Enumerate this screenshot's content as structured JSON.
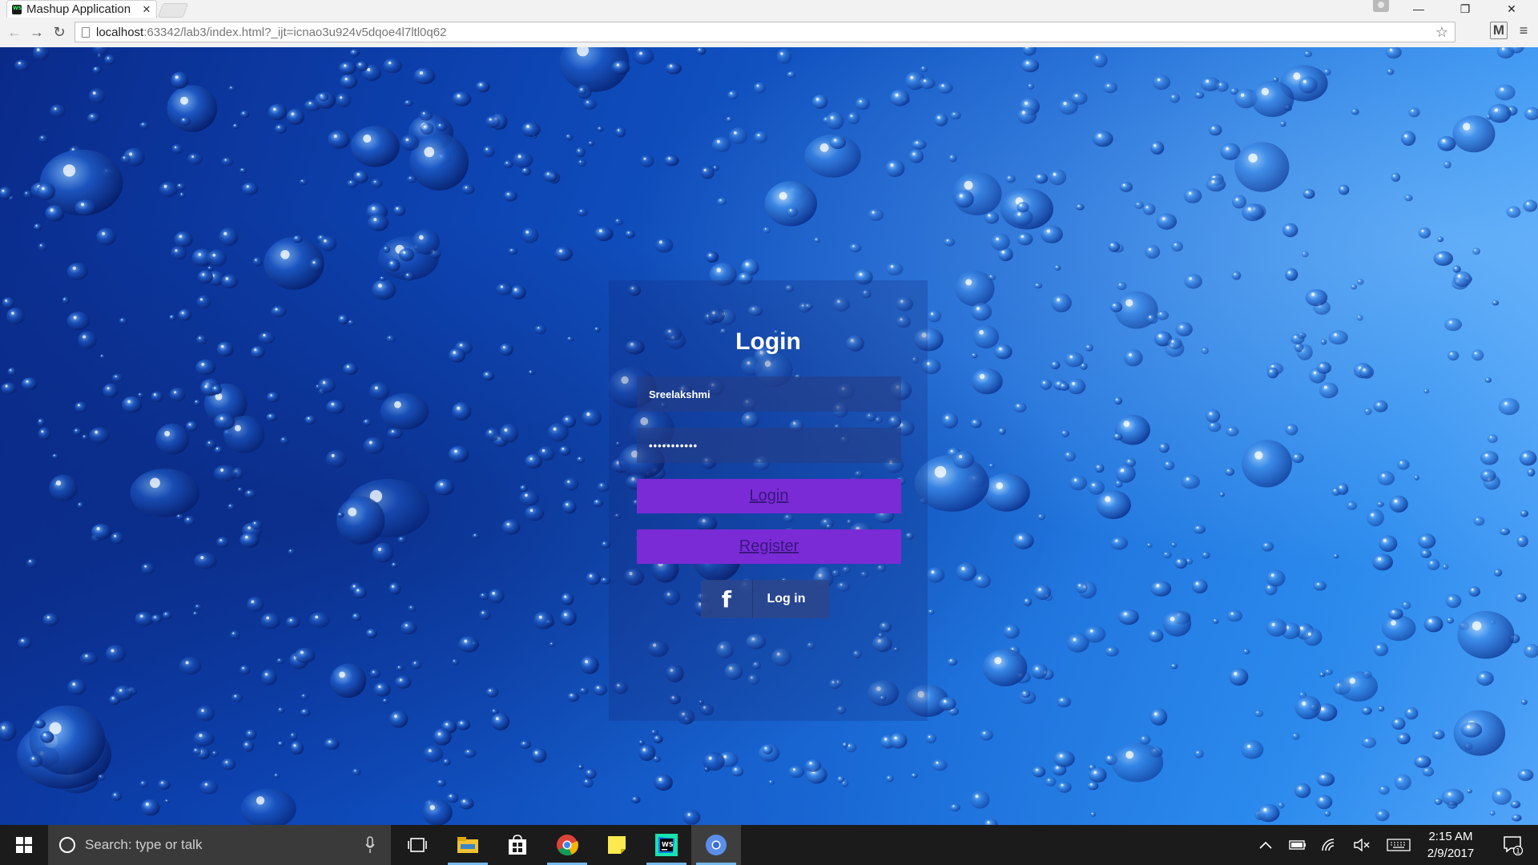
{
  "browser": {
    "tab_title": "Mashup Application",
    "url_host": "localhost",
    "url_rest": ":63342/lab3/index.html?_ijt=icnao3u924v5dqoe4l7ltl0q62",
    "extension_label": "M"
  },
  "login": {
    "title": "Login",
    "username_value": "Sreelakshmi",
    "password_value": "•••••••••••",
    "login_button": "Login",
    "register_button": "Register",
    "facebook_button": "Log in"
  },
  "taskbar": {
    "search_placeholder": "Search: type or talk",
    "time": "2:15 AM",
    "date": "2/9/2017",
    "notification_count": "1"
  },
  "colors": {
    "accent_purple": "#7b2bd6",
    "background_blue": "#1662d0",
    "taskbar": "#1b1b1b"
  }
}
